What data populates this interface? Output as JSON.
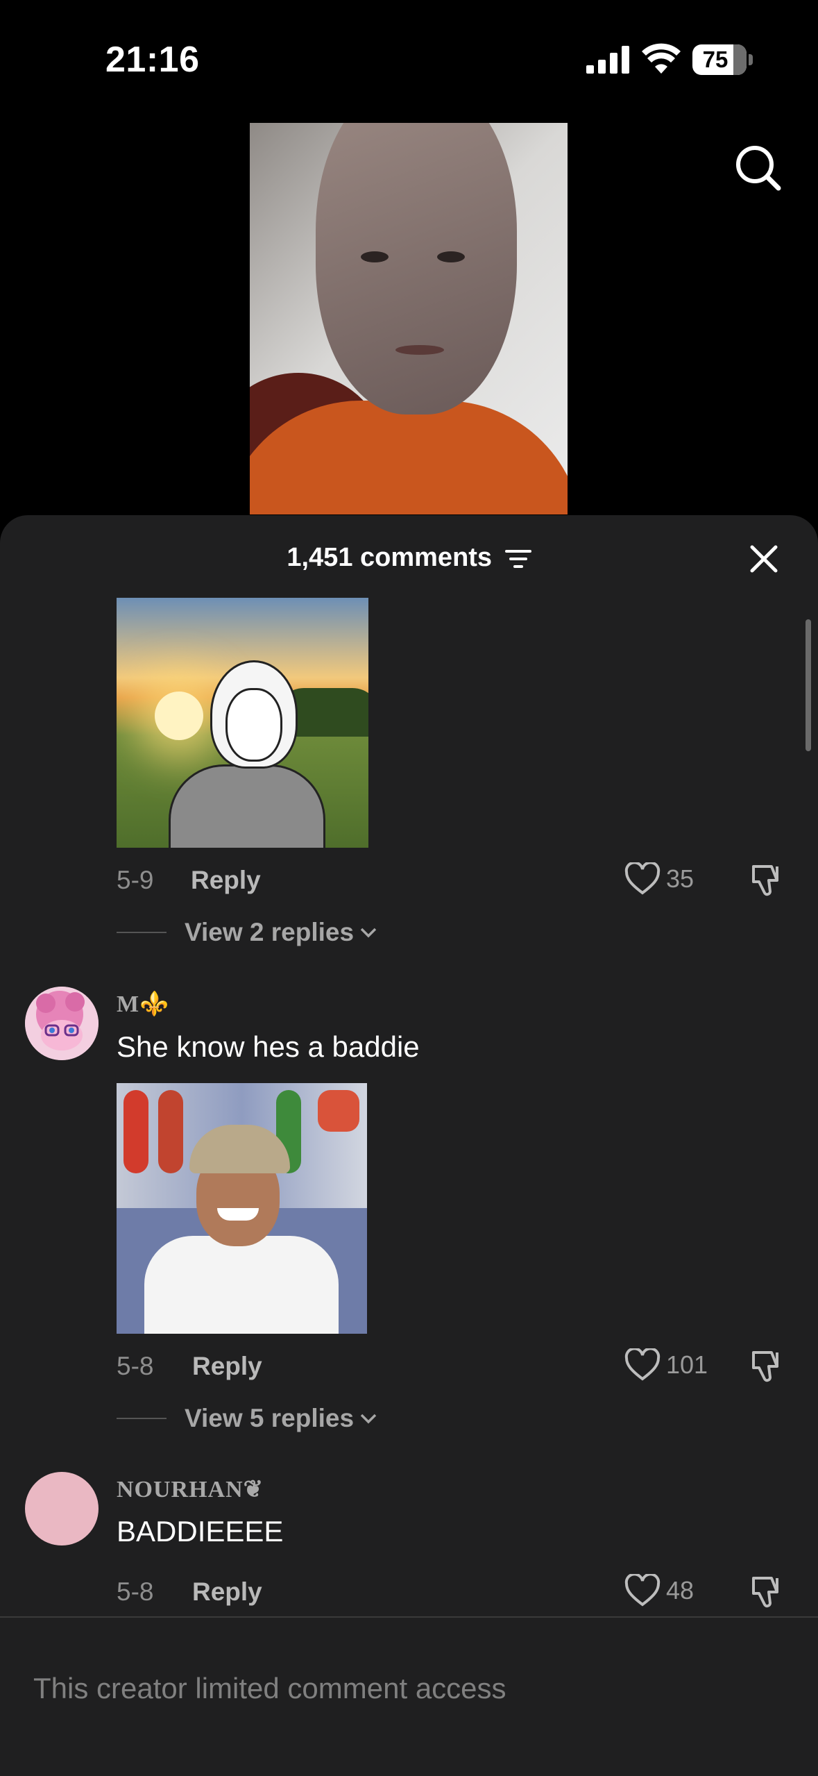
{
  "status_bar": {
    "time": "21:16",
    "battery_level": "75"
  },
  "sheet": {
    "comment_count": "1,451 comments"
  },
  "comments": [
    {
      "date": "5-9",
      "reply_label": "Reply",
      "likes": "35",
      "view_replies": "View 2 replies"
    },
    {
      "username": "M⚜️",
      "text": "She know hes a baddie",
      "date": "5-8",
      "reply_label": "Reply",
      "likes": "101",
      "view_replies": "View 5 replies"
    },
    {
      "username": "NOURHAN❦",
      "text": "BADDIEEEE",
      "date": "5-8",
      "reply_label": "Reply",
      "likes": "48"
    }
  ],
  "footer": {
    "limited_text": "This creator limited comment access"
  },
  "colors": {
    "sheet_bg": "#1f1f20",
    "muted_text": "#8e8e8e",
    "avatar_pink": "#eab8c3"
  }
}
